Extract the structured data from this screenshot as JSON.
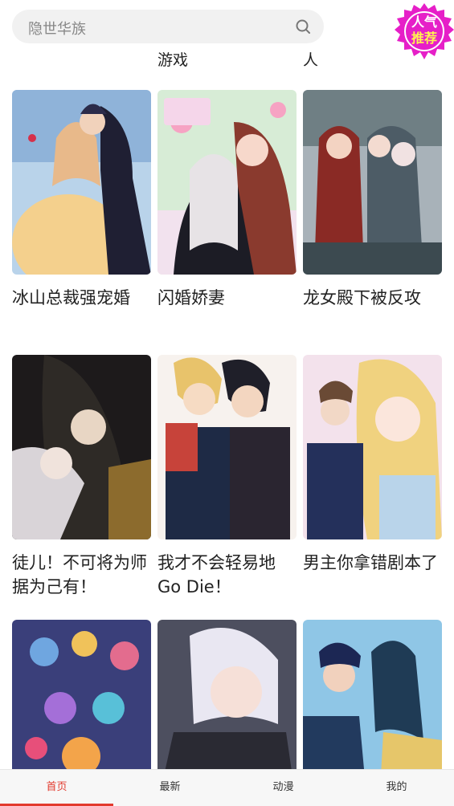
{
  "search": {
    "placeholder": "隐世华族"
  },
  "badge": {
    "line1": "人气",
    "line2": "推荐"
  },
  "partial_titles": [
    "游戏",
    "人"
  ],
  "comics": [
    {
      "title": "冰山总裁强宠婚"
    },
    {
      "title": "闪婚娇妻"
    },
    {
      "title": "龙女殿下被反攻"
    },
    {
      "title": "徒儿！不可将为师据为己有！"
    },
    {
      "title": "我才不会轻易地Go Die！"
    },
    {
      "title": "男主你拿错剧本了"
    },
    {
      "title": ""
    },
    {
      "title": ""
    },
    {
      "title": ""
    }
  ],
  "tabs": [
    {
      "label": "首页",
      "active": true
    },
    {
      "label": "最新",
      "active": false
    },
    {
      "label": "动漫",
      "active": false
    },
    {
      "label": "我的",
      "active": false
    }
  ],
  "colors": {
    "accent": "#e23a2e",
    "badge": "#e61fc8"
  }
}
